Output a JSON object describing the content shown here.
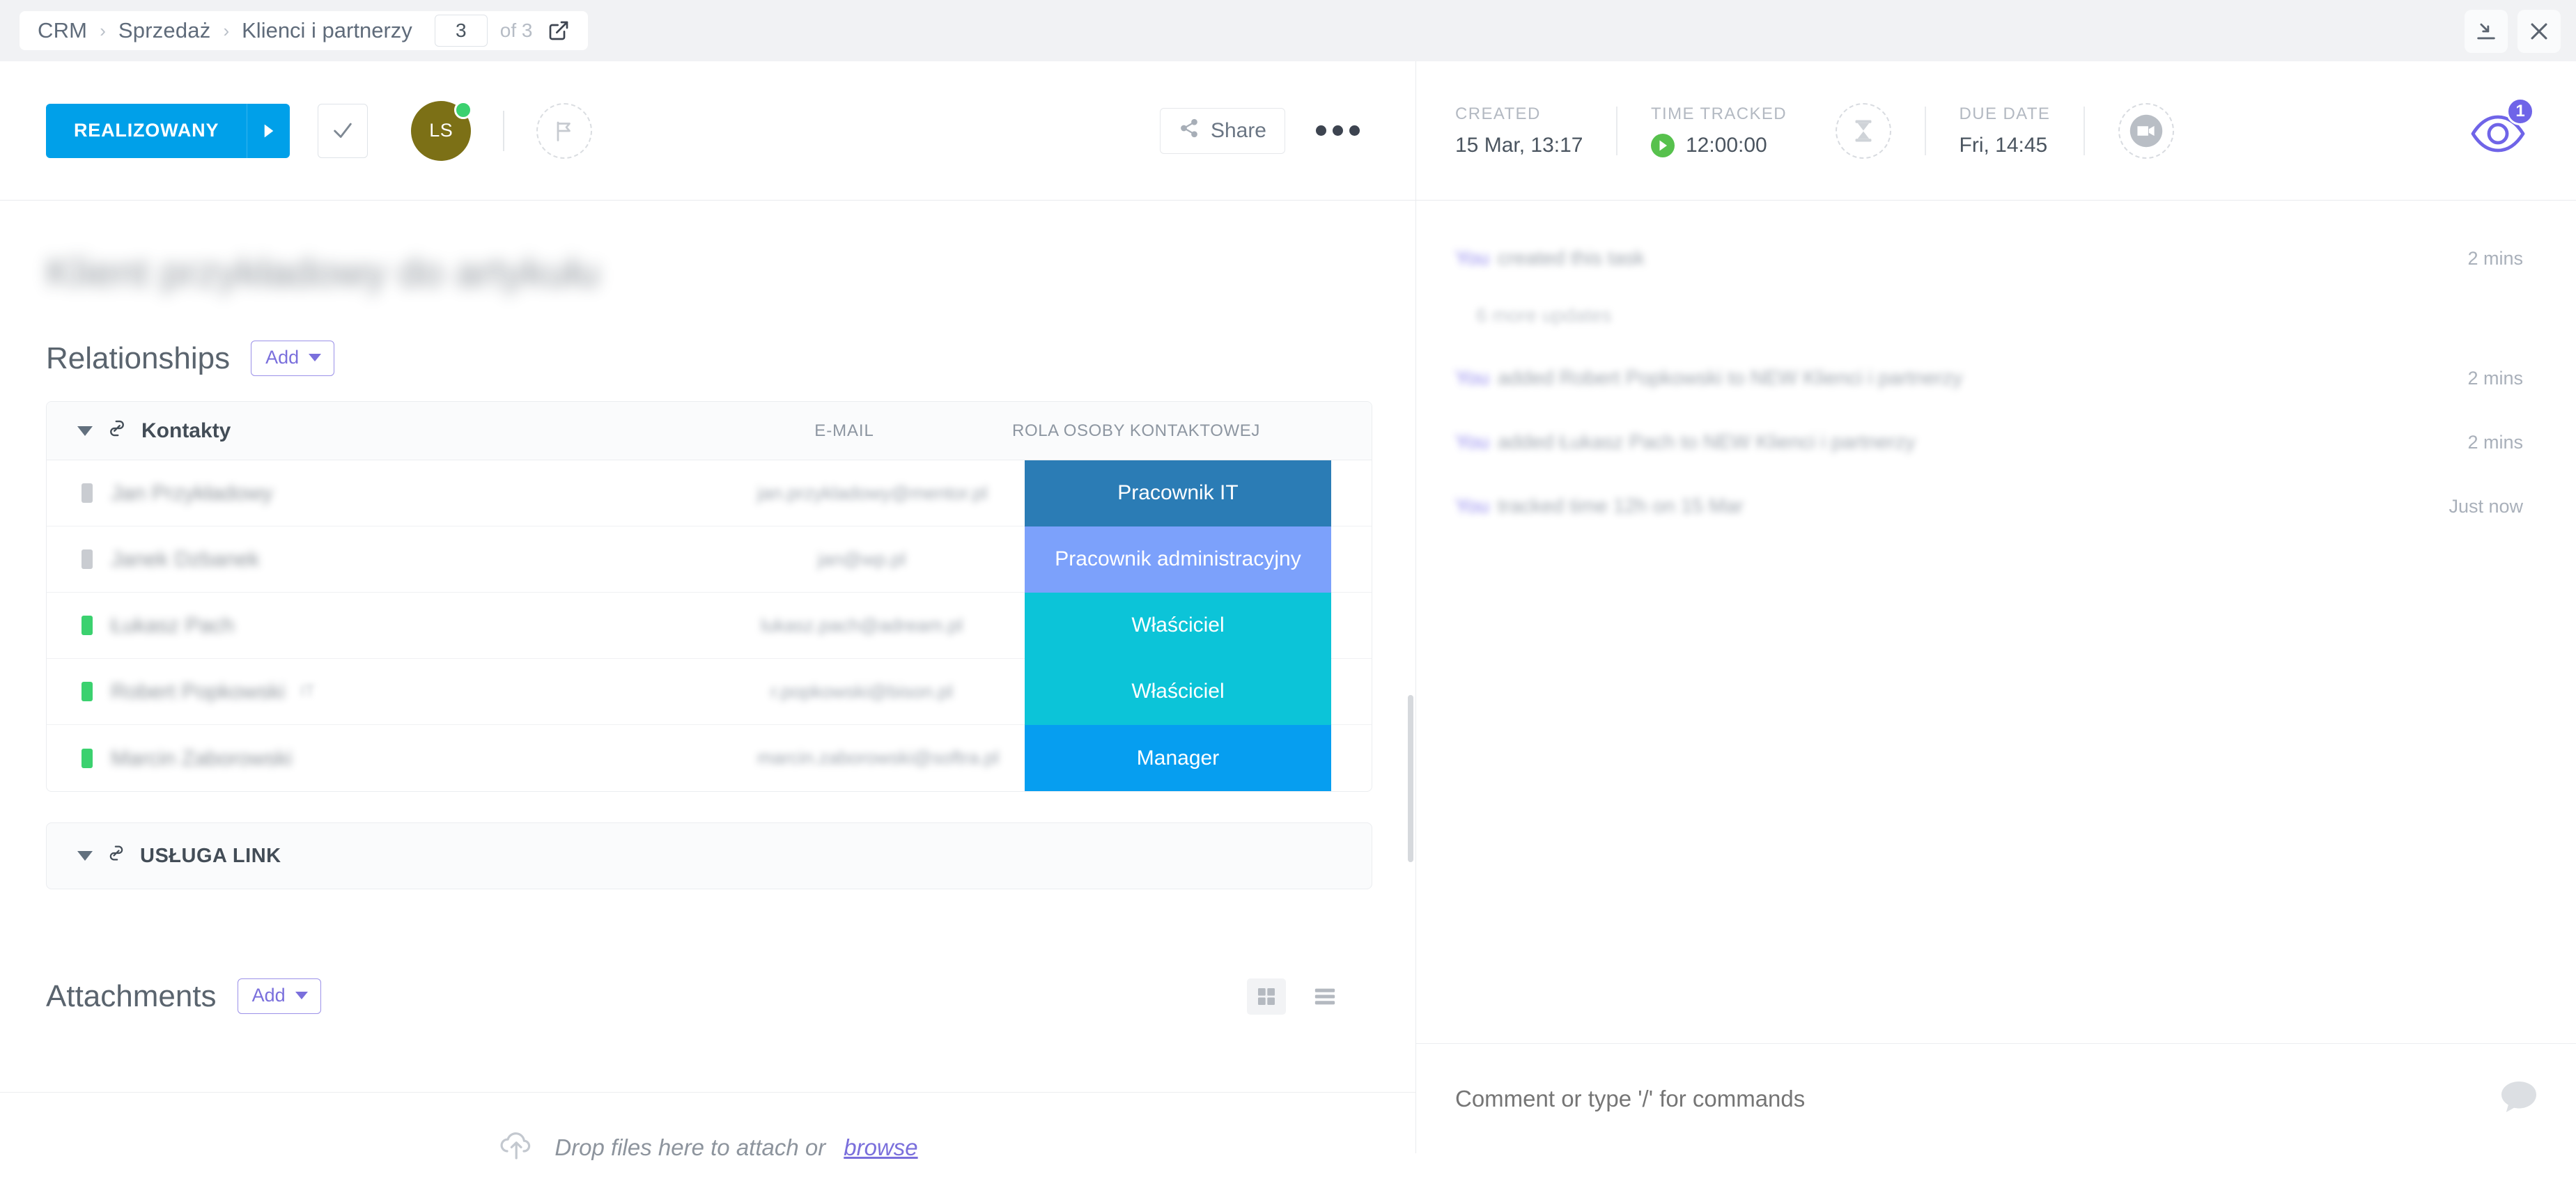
{
  "window": {
    "minimize_label": "minimize",
    "close_label": "close"
  },
  "breadcrumb": {
    "items": [
      "CRM",
      "Sprzedaż",
      "Klienci i partnerzy"
    ],
    "separator": "›",
    "page_number": "3",
    "page_total": "of 3",
    "open_icon": "open-external-icon"
  },
  "toolbar": {
    "status_label": "REALIZOWANY",
    "status_color": "#00a0e9",
    "status_caret_icon": "caret-right-icon",
    "complete_icon": "check-icon",
    "assignee_initials": "LS",
    "assignee_color": "#7c7016",
    "assignee_online_color": "#3bd16f",
    "priority_icon": "flag-icon",
    "share_label": "Share",
    "share_icon": "share-icon",
    "more_icon": "ellipsis-icon"
  },
  "task": {
    "title": "Klient przykładowy do artykułu"
  },
  "relationships": {
    "heading": "Relationships",
    "add_label": "Add",
    "group": {
      "name": "Kontakty",
      "collapse_icon": "triangle-down-icon",
      "link_icon": "relationship-link-icon",
      "columns": [
        "E-MAIL",
        "ROLA OSOBY KONTAKTOWEJ"
      ],
      "rows": [
        {
          "status_color": "#c9ccd1",
          "name": "Jan Przykładowy",
          "extra": "",
          "email": "jan.przykladowy@mentor.pl",
          "role": "Pracownik IT",
          "role_color": "#2b7cb5"
        },
        {
          "status_color": "#c9ccd1",
          "name": "Janek Dzbanek",
          "extra": "",
          "email": "jan@wp.pl",
          "role": "Pracownik administracyjny",
          "role_color": "#7ca1fb"
        },
        {
          "status_color": "#3bd16f",
          "name": "Łukasz Pach",
          "extra": "",
          "email": "lukasz.pach@adream.pl",
          "role": "Właściciel",
          "role_color": "#0cc4d8"
        },
        {
          "status_color": "#3bd16f",
          "name": "Robert Popkowski",
          "extra": "IT",
          "email": "r.popkowski@bison.pl",
          "role": "Właściciel",
          "role_color": "#0cc4d8"
        },
        {
          "status_color": "#3bd16f",
          "name": "Marcin Zaborowski",
          "extra": "",
          "email": "marcin.zaborowski@softra.pl",
          "role": "Manager",
          "role_color": "#069ef0"
        }
      ]
    },
    "collapsed_group": {
      "name": "USŁUGA LINK",
      "collapse_icon": "triangle-down-icon",
      "link_icon": "relationship-link-icon"
    }
  },
  "attachments": {
    "heading": "Attachments",
    "add_label": "Add",
    "grid_view_icon": "grid-view-icon",
    "list_view_icon": "list-view-icon",
    "dropzone_icon": "cloud-upload-icon",
    "dropzone_text": "Drop files here to attach or",
    "dropzone_browse": "browse"
  },
  "details": {
    "created_label": "CREATED",
    "created_value": "15 Mar, 13:17",
    "time_tracked_label": "TIME TRACKED",
    "time_tracked_value": "12:00:00",
    "timer_icon": "play-icon",
    "estimate_icon": "hourglass-icon",
    "due_date_label": "DUE DATE",
    "due_date_value": "Fri, 14:45",
    "video_icon": "video-camera-icon",
    "watchers_icon": "eye-icon",
    "watchers_count": "1",
    "watchers_color": "#6f64e8"
  },
  "activity": {
    "entries": [
      {
        "actor": "You",
        "text": "created this task",
        "time": "2 mins"
      },
      {
        "actor": "",
        "text": "6 more updates",
        "time": ""
      },
      {
        "actor": "You",
        "text": "added Robert Popkowski to NEW Klienci i partnerzy",
        "time": "2 mins"
      },
      {
        "actor": "You",
        "text": "added Łukasz Pach to NEW Klienci i partnerzy",
        "time": "2 mins"
      },
      {
        "actor": "You",
        "text": "tracked time 12h on 15 Mar",
        "time": "Just now"
      }
    ]
  },
  "comment": {
    "placeholder": "Comment or type '/' for commands",
    "icon": "chat-bubble-icon"
  }
}
